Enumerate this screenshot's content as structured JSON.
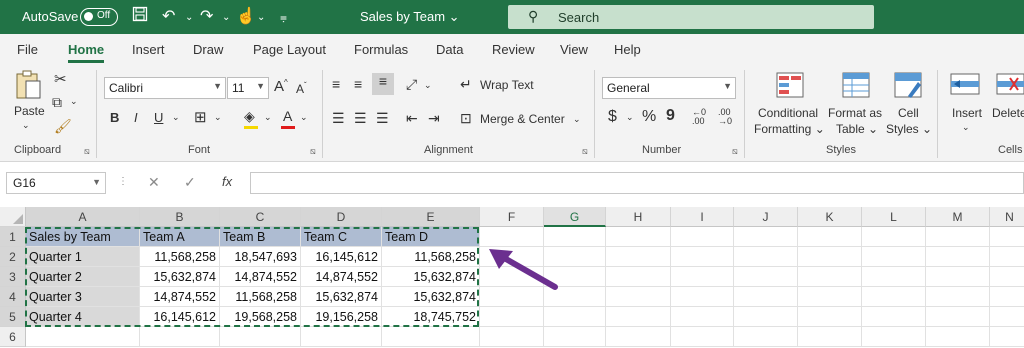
{
  "titlebar": {
    "autosave_label": "AutoSave",
    "autosave_state": "Off",
    "doc_title": "Sales by Team",
    "search_placeholder": "Search"
  },
  "tabs": [
    "File",
    "Home",
    "Insert",
    "Draw",
    "Page Layout",
    "Formulas",
    "Data",
    "Review",
    "View",
    "Help"
  ],
  "active_tab": "Home",
  "ribbon": {
    "clipboard": {
      "paste": "Paste",
      "label": "Clipboard"
    },
    "font": {
      "name": "Calibri",
      "size": "11",
      "bold": "B",
      "italic": "I",
      "underline": "U",
      "label": "Font",
      "grow": "A",
      "shrink": "A"
    },
    "alignment": {
      "wrap": "Wrap Text",
      "merge": "Merge & Center",
      "label": "Alignment"
    },
    "number": {
      "format": "General",
      "dollar": "$",
      "percent": "%",
      "comma": "9",
      "label": "Number"
    },
    "styles": {
      "conditional": "Conditional",
      "conditional2": "Formatting",
      "format_table": "Format as",
      "format_table2": "Table",
      "cell_styles": "Cell",
      "cell_styles2": "Styles",
      "label": "Styles"
    },
    "cells": {
      "insert": "Insert",
      "delete": "Delete",
      "label": "Cells"
    }
  },
  "formula_bar": {
    "name_box": "G16",
    "fx": "fx",
    "value": ""
  },
  "columns": [
    "A",
    "B",
    "C",
    "D",
    "E",
    "F",
    "G",
    "H",
    "I",
    "J",
    "K",
    "L",
    "M",
    "N"
  ],
  "rows": [
    "1",
    "2",
    "3",
    "4",
    "5",
    "6"
  ],
  "sheet": {
    "header": [
      "Sales by Team",
      "Team A",
      "Team B",
      "Team C",
      "Team D"
    ],
    "data": [
      [
        "Quarter 1",
        "11,568,258",
        "18,547,693",
        "16,145,612",
        "11,568,258"
      ],
      [
        "Quarter 2",
        "15,632,874",
        "14,874,552",
        "14,874,552",
        "15,632,874"
      ],
      [
        "Quarter 3",
        "14,874,552",
        "11,568,258",
        "15,632,874",
        "15,632,874"
      ],
      [
        "Quarter 4",
        "16,145,612",
        "19,568,258",
        "19,156,258",
        "18,745,752"
      ]
    ]
  },
  "colors": {
    "brand": "#217346",
    "header_fill": "#aebcd2",
    "label_fill": "#d9d9d9",
    "arrow": "#6b2f8f"
  }
}
